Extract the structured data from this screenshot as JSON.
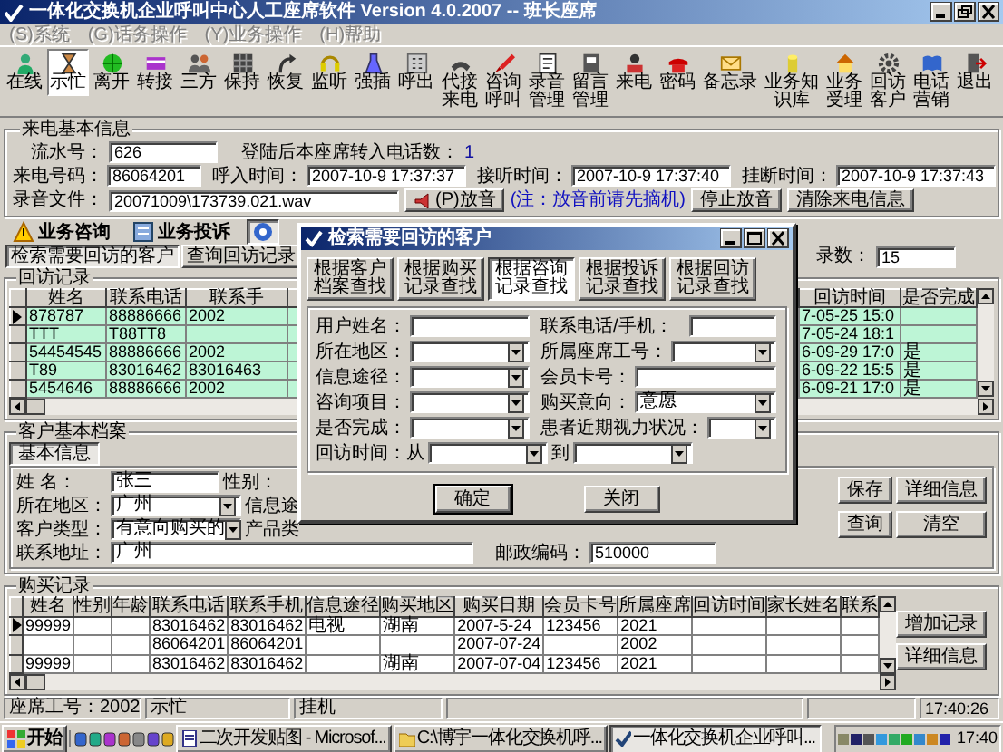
{
  "window": {
    "title": "一体化交换机企业呼叫中心人工座席软件 Version 4.0.2007 -- 班长座席"
  },
  "menu": [
    {
      "label": "(S)系统",
      "disabled": true
    },
    {
      "label": "(G)话务操作",
      "disabled": true
    },
    {
      "label": "(Y)业务操作",
      "disabled": true
    },
    {
      "label": "(H)帮助",
      "disabled": true
    }
  ],
  "toolbar": [
    {
      "label": "在线",
      "selected": false
    },
    {
      "label": "示忙",
      "selected": true
    },
    {
      "label": "离开",
      "selected": false
    },
    {
      "label": "转接",
      "selected": false
    },
    {
      "label": "三方",
      "selected": false
    },
    {
      "label": "保持",
      "selected": false
    },
    {
      "label": "恢复",
      "selected": false
    },
    {
      "label": "监听",
      "selected": false
    },
    {
      "label": "强插",
      "selected": false
    },
    {
      "label": "呼出",
      "selected": false
    },
    {
      "label": "代接来电",
      "selected": false
    },
    {
      "label": "咨询呼叫",
      "selected": false
    },
    {
      "label": "录音管理",
      "selected": false
    },
    {
      "label": "留言管理",
      "selected": false
    },
    {
      "label": "来电",
      "selected": false
    },
    {
      "label": "密码",
      "selected": false
    },
    {
      "label": "备忘录",
      "selected": false
    },
    {
      "label": "业务知识库",
      "selected": false
    },
    {
      "label": "业务受理",
      "selected": false
    },
    {
      "label": "回访客户",
      "selected": false
    },
    {
      "label": "电话营销",
      "selected": false
    },
    {
      "label": "退出",
      "selected": false
    }
  ],
  "call_info": {
    "legend": "来电基本信息",
    "serial": {
      "label": "流水号：",
      "value": "626"
    },
    "transfer_count": {
      "label": "登陆后本座席转入电话数：",
      "value": "1"
    },
    "caller": {
      "label": "来电号码：",
      "value": "86064201"
    },
    "times": [
      {
        "label": "呼入时间：",
        "value": "2007-10-9 17:37:37"
      },
      {
        "label": "接听时间：",
        "value": "2007-10-9 17:37:40"
      },
      {
        "label": "挂断时间：",
        "value": "2007-10-9 17:37:43"
      }
    ],
    "recording": {
      "label": "录音文件：",
      "value": "20071009\\173739.021.wav"
    },
    "play_button": "(P)放音",
    "note": "(注：放音前请先摘机)",
    "buttons": [
      "停止放音",
      "清除来电信息"
    ]
  },
  "business_tabs": [
    {
      "label": "业务咨询",
      "selected": false
    },
    {
      "label": "业务投诉",
      "selected": false
    },
    {
      "selected": true
    }
  ],
  "callback": {
    "buttons": [
      {
        "label": "检索需要回访的客户",
        "selected": true
      },
      {
        "label": "查询回访记录",
        "selected": false
      }
    ],
    "record_count": {
      "label": "录数：",
      "value": "15"
    },
    "legend": "回访记录",
    "columns_left": [
      "姓名",
      "联系电话",
      "联系手"
    ],
    "columns_right": [
      "回访时间",
      "是否完成"
    ],
    "rows": [
      {
        "selected": true,
        "name": "878787",
        "phone": "88886666",
        "mobile": "2002",
        "callback_time": "7-05-25 15:0"
      },
      {
        "selected": false,
        "name": "TTT",
        "phone": "T88TT8",
        "callback_time": "7-05-24 18:1"
      },
      {
        "selected": false,
        "name": "54454545",
        "phone": "88886666",
        "mobile": "2002",
        "callback_time": "6-09-29 17:0",
        "done": "是"
      },
      {
        "selected": false,
        "name": "T89",
        "phone": "83016462",
        "mobile": "83016463",
        "callback_time": "6-09-22 15:5",
        "done": "是"
      },
      {
        "selected": false,
        "name": "5454646",
        "phone": "88886666",
        "mobile": "2002",
        "callback_time": "6-09-21 17:0",
        "done": "是"
      }
    ]
  },
  "customer": {
    "legend": "客户基本档案",
    "tab": "基本信息",
    "rows": [
      {
        "label": "姓 名：",
        "kind": "text",
        "value": "张三",
        "next_label": "性别："
      },
      {
        "label": "所在地区：",
        "kind": "select",
        "value": "广州",
        "next_label": "信息途"
      },
      {
        "label": "客户类型：",
        "kind": "select",
        "value": "有意向购买的",
        "next_label": "产品类"
      }
    ],
    "address": {
      "label": "联系地址：",
      "value": "广州"
    },
    "postcode": {
      "label": "邮政编码：",
      "value": "510000"
    },
    "buttons": [
      "保存",
      "详细信息",
      "查询",
      "清空"
    ]
  },
  "dialog": {
    "title": "检索需要回访的客户",
    "tabs": [
      {
        "label": "根据客户档案查找",
        "selected": false
      },
      {
        "label": "根据购买记录查找",
        "selected": false
      },
      {
        "label": "根据咨询记录查找",
        "selected": true
      },
      {
        "label": "根据投诉记录查找",
        "selected": false
      },
      {
        "label": "根据回访记录查找",
        "selected": false
      }
    ],
    "fields_left": [
      {
        "label": "用户姓名：",
        "kind": "text"
      },
      {
        "label": "所在地区：",
        "kind": "select"
      },
      {
        "label": "信息途径：",
        "kind": "select"
      },
      {
        "label": "咨询项目：",
        "kind": "select"
      },
      {
        "label": "是否完成：",
        "kind": "select"
      }
    ],
    "fields_right": [
      {
        "label": "联系电话/手机：",
        "kind": "text"
      },
      {
        "label": "所属座席工号：",
        "kind": "select"
      },
      {
        "label": "会员卡号：",
        "kind": "text"
      },
      {
        "label": "购买意向：",
        "kind": "select",
        "value": "意愿"
      },
      {
        "label": "患者近期视力状况：",
        "kind": "select"
      }
    ],
    "date_range": {
      "label": "回访时间：从",
      "to_label": "到"
    },
    "buttons": [
      {
        "label": "确定",
        "default": true
      },
      {
        "label": "关闭",
        "default": false
      }
    ]
  },
  "purchases": {
    "legend": "购买记录",
    "columns": [
      "姓名",
      "性别",
      "年龄",
      "联系电话",
      "联系手机",
      "信息途径",
      "购买地区",
      "购买日期",
      "会员卡号",
      "所属座席",
      "回访时间",
      "家长姓名",
      "联系"
    ],
    "rows": [
      {
        "selected": true,
        "name": "99999",
        "phone": "83016462",
        "mobile": "83016462",
        "source": "电视",
        "region": "湖南",
        "date": "2007-5-24",
        "card": "123456",
        "seat": "2021"
      },
      {
        "selected": false,
        "phone": "86064201",
        "mobile": "86064201",
        "date": "2007-07-24",
        "seat": "2002"
      },
      {
        "selected": false,
        "name": "99999",
        "phone": "83016462",
        "mobile": "83016462",
        "region": "湖南",
        "date": "2007-07-04",
        "card": "123456",
        "seat": "2021"
      }
    ],
    "buttons": [
      "增加记录",
      "详细信息"
    ]
  },
  "status_bar": {
    "agent": "座席工号：2002",
    "state": "示忙",
    "line": "挂机",
    "time": "17:40:26"
  },
  "taskbar": {
    "start": "开始",
    "tasks": [
      {
        "label": "二次开发贴图 - Microsof...",
        "selected": false
      },
      {
        "label": "C:\\博宇一体化交换机呼...",
        "selected": false
      },
      {
        "label": "一体化交换机企业呼叫...",
        "selected": true
      }
    ],
    "clock": "17:40"
  }
}
